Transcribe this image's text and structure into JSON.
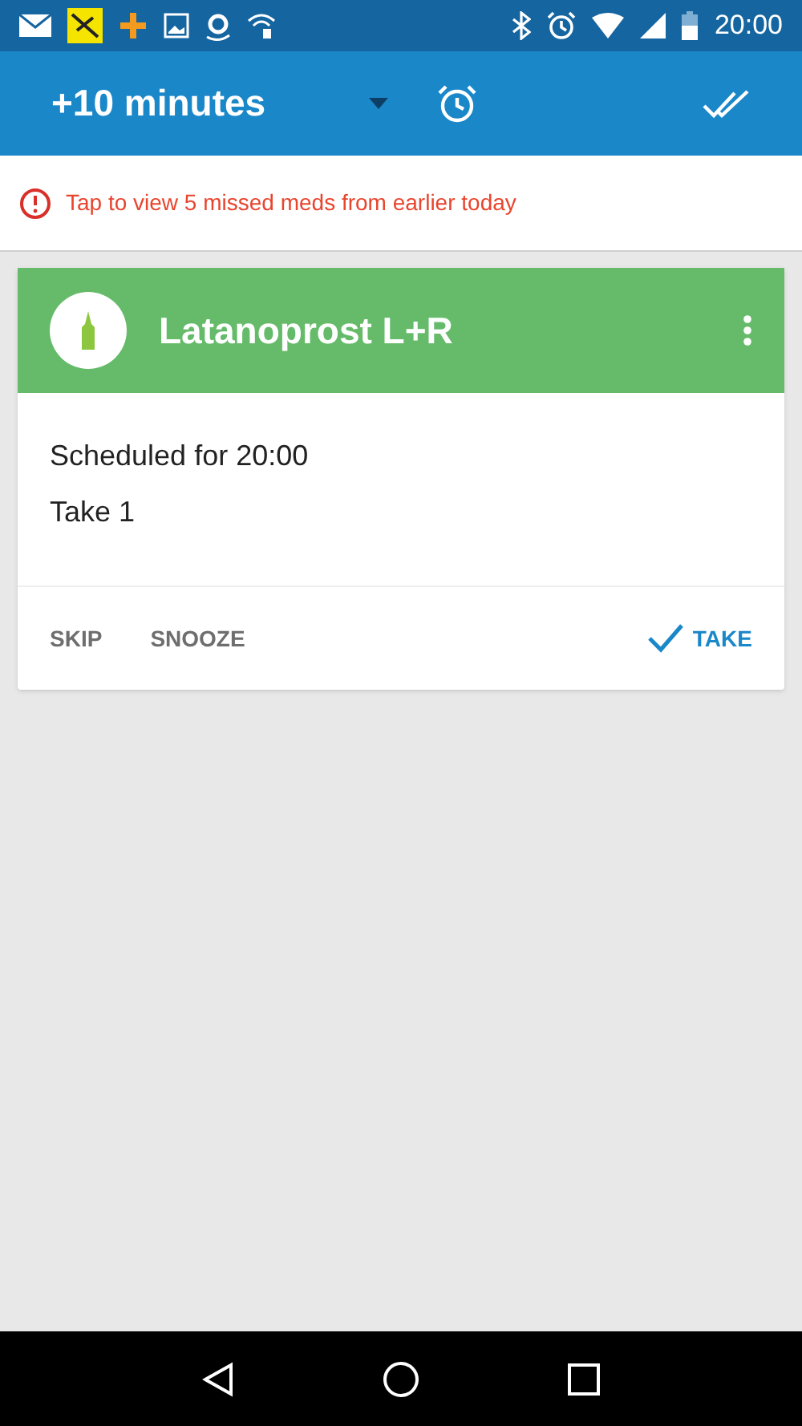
{
  "status_bar": {
    "time": "20:00"
  },
  "toolbar": {
    "title": "+10 minutes"
  },
  "banner": {
    "text": "Tap to view 5 missed meds from earlier today"
  },
  "card": {
    "title": "Latanoprost L+R",
    "lines": [
      "Scheduled for 20:00",
      "Take 1"
    ],
    "actions": [
      {
        "label": "SKIP",
        "kind": "plain"
      },
      {
        "label": "SNOOZE",
        "kind": "plain"
      },
      {
        "label": "TAKE",
        "kind": "primary"
      }
    ]
  }
}
